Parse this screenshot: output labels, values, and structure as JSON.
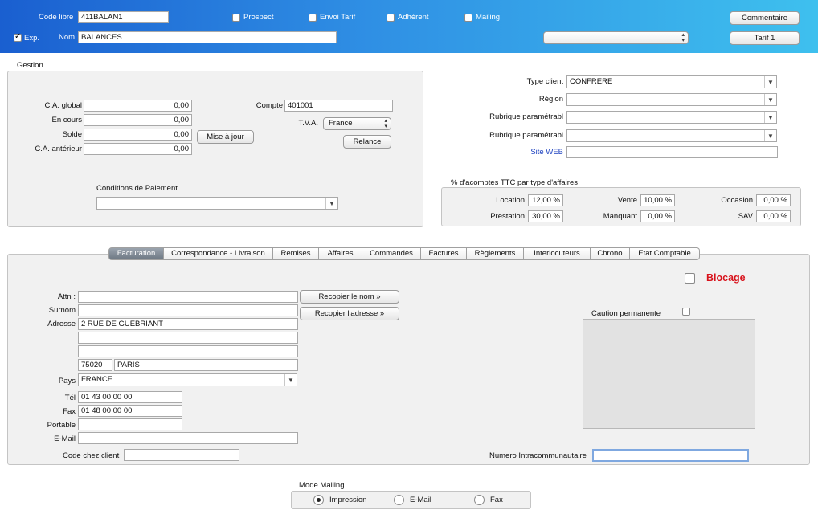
{
  "header": {
    "code_libre_label": "Code libre",
    "code_libre_value": "411BALAN1",
    "exp_label": "Exp.",
    "nom_label": "Nom",
    "nom_value": "BALANCES",
    "prospect_label": "Prospect",
    "envoi_tarif_label": "Envoi Tarif",
    "adherent_label": "Adhérent",
    "mailing_label": "Mailing",
    "commentaire_label": "Commentaire",
    "tarif_label": "Tarif 1",
    "select_value": ""
  },
  "gestion": {
    "title": "Gestion",
    "ca_global_label": "C.A. global",
    "ca_global_value": "0,00",
    "en_cours_label": "En cours",
    "en_cours_value": "0,00",
    "solde_label": "Solde",
    "solde_value": "0,00",
    "ca_anterieur_label": "C.A. antérieur",
    "ca_anterieur_value": "0,00",
    "mise_a_jour_label": "Mise à jour",
    "compte_label": "Compte",
    "compte_value": "401001",
    "tva_label": "T.V.A.",
    "tva_value": "France",
    "relance_label": "Relance",
    "conditions_label": "Conditions de Paiement",
    "conditions_value": ""
  },
  "client": {
    "type_client_label": "Type client",
    "type_client_value": "CONFRERE",
    "region_label": "Région",
    "region_value": "",
    "rubrique1_label": "Rubrique paramétrabl",
    "rubrique1_value": "",
    "rubrique2_label": "Rubrique paramétrabl",
    "rubrique2_value": "",
    "site_web_label": "Site WEB",
    "site_web_value": ""
  },
  "acomptes": {
    "title": "% d'acomptes TTC par type d'affaires",
    "location_label": "Location",
    "location_value": "12,00 %",
    "vente_label": "Vente",
    "vente_value": "10,00 %",
    "occasion_label": "Occasion",
    "occasion_value": "0,00 %",
    "prestation_label": "Prestation",
    "prestation_value": "30,00 %",
    "manquant_label": "Manquant",
    "manquant_value": "0,00 %",
    "sav_label": "SAV",
    "sav_value": "0,00 %"
  },
  "tabs": [
    "Facturation",
    "Correspondance - Livraison",
    "Remises",
    "Affaires",
    "Commandes",
    "Factures",
    "Règlements",
    "Interlocuteurs",
    "Chrono",
    "Etat Comptable"
  ],
  "facturation": {
    "attn_label": "Attn :",
    "attn_value": "",
    "surnom_label": "Surnom",
    "surnom_value": "",
    "adresse_label": "Adresse",
    "adresse1": "2 RUE DE GUEBRIANT",
    "adresse2": "",
    "adresse3": "",
    "cp": "75020",
    "ville": "PARIS",
    "pays_label": "Pays",
    "pays_value": "FRANCE",
    "tel_label": "Tél",
    "tel_value": "01 43 00 00 00",
    "fax_label": "Fax",
    "fax_value": "01 48 00 00 00",
    "portable_label": "Portable",
    "portable_value": "",
    "email_label": "E-Mail",
    "email_value": "",
    "code_chez_client_label": "Code chez client",
    "code_chez_client_value": "",
    "recopier_nom_label": "Recopier le nom »",
    "recopier_adresse_label": "Recopier l'adresse »",
    "blocage_label": "Blocage",
    "caution_label": "Caution permanente",
    "numero_intra_label": "Numero Intracommunautaire",
    "numero_intra_value": ""
  },
  "mode_mailing": {
    "title": "Mode Mailing",
    "options": [
      "Impression",
      "E-Mail",
      "Fax"
    ],
    "selected": "Impression"
  },
  "colors": {
    "header_start": "#1a5fd0",
    "header_end": "#3fc0f0",
    "blocage_red": "#d8121b",
    "link_blue": "#1a3fbf"
  }
}
